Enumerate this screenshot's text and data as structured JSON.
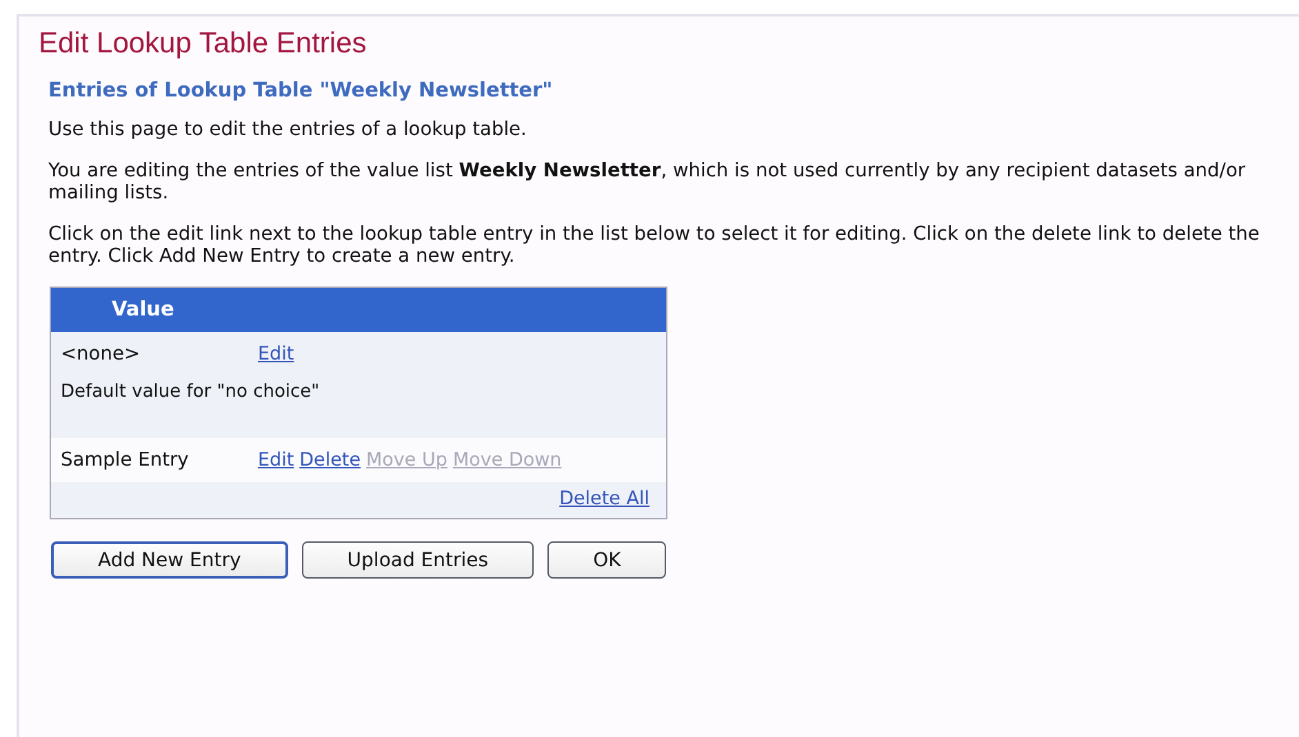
{
  "title": "Edit Lookup Table Entries",
  "subtitle": "Entries of Lookup Table \"Weekly Newsletter\"",
  "paragraphs": [
    "Use this page to edit the entries of a lookup table.",
    "You are editing the entries of the value list **Weekly Newsletter**, which is not used currently by any recipient datasets and/or mailing lists.",
    "Click on the edit link next to the lookup table entry in the list below to select it for editing. Click on the delete link to delete the entry. Click Add New Entry to create a new entry."
  ],
  "table": {
    "columns": [
      "Value"
    ],
    "rows": [
      {
        "value": "<none>",
        "description": "Default value for \"no choice\"",
        "links": [
          {
            "label": "Edit",
            "disabled": false
          }
        ]
      },
      {
        "value": "Sample Entry",
        "links": [
          {
            "label": "Edit",
            "disabled": false
          },
          {
            "label": "Delete",
            "disabled": false
          },
          {
            "label": "Move Up",
            "disabled": true
          },
          {
            "label": "Move Down",
            "disabled": true
          }
        ]
      }
    ],
    "footer_link": "Delete All"
  },
  "buttons": [
    {
      "label": "Add New Entry",
      "default": true
    },
    {
      "label": "Upload Entries",
      "default": false
    },
    {
      "label": "OK",
      "default": false
    }
  ]
}
